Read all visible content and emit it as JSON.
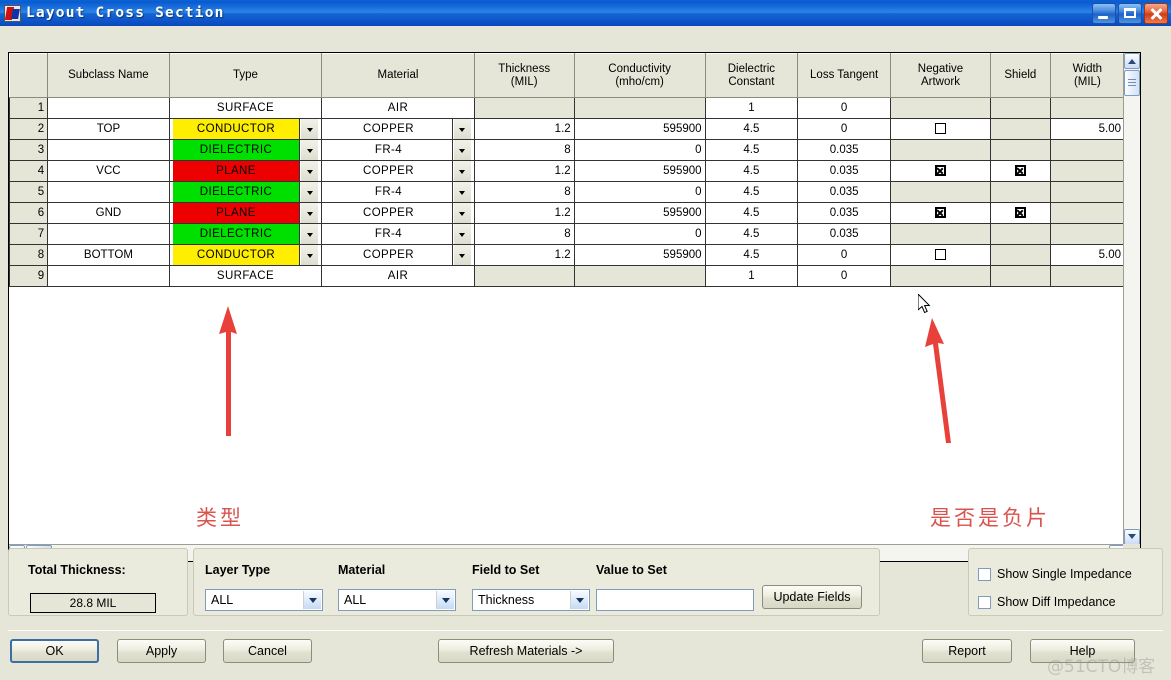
{
  "window": {
    "title": "Layout Cross Section",
    "icon": "app-icon",
    "buttons": {
      "minimize": "minimize",
      "maximize": "maximize",
      "close": "close"
    }
  },
  "grid": {
    "columns": [
      {
        "key": "rownum",
        "label": ""
      },
      {
        "key": "subclass",
        "label": "Subclass Name"
      },
      {
        "key": "type",
        "label": "Type"
      },
      {
        "key": "material",
        "label": "Material"
      },
      {
        "key": "thickness",
        "label": "Thickness\n(MIL)"
      },
      {
        "key": "conductivity",
        "label": "Conductivity\n(mho/cm)"
      },
      {
        "key": "dielectric",
        "label": "Dielectric\nConstant"
      },
      {
        "key": "loss",
        "label": "Loss Tangent"
      },
      {
        "key": "negative",
        "label": "Negative\nArtwork"
      },
      {
        "key": "shield",
        "label": "Shield"
      },
      {
        "key": "width",
        "label": "Width\n(MIL)"
      }
    ],
    "header_lines": {
      "thickness": [
        "Thickness",
        "(MIL)"
      ],
      "conductivity": [
        "Conductivity",
        "(mho/cm)"
      ],
      "dielectric": [
        "Dielectric",
        "Constant"
      ],
      "loss": [
        "Loss Tangent"
      ],
      "negative": [
        "Negative",
        "Artwork"
      ],
      "shield": [
        "Shield"
      ],
      "width": [
        "Width",
        "(MIL)"
      ],
      "subclass": [
        "Subclass Name"
      ],
      "type": [
        "Type"
      ],
      "material": [
        "Material"
      ]
    },
    "rows": [
      {
        "n": "1",
        "subclass": "",
        "type": "SURFACE",
        "type_color": "none",
        "type_combo": false,
        "material": "AIR",
        "material_combo": false,
        "thickness": "",
        "conductivity": "",
        "dielectric": "1",
        "loss": "0",
        "negative": "none",
        "shield": "none",
        "width": ""
      },
      {
        "n": "2",
        "subclass": "TOP",
        "type": "CONDUCTOR",
        "type_color": "yellow",
        "type_combo": true,
        "material": "COPPER",
        "material_combo": true,
        "thickness": "1.2",
        "conductivity": "595900",
        "dielectric": "4.5",
        "loss": "0",
        "negative": "unchecked",
        "shield": "none",
        "width": "5.00"
      },
      {
        "n": "3",
        "subclass": "",
        "type": "DIELECTRIC",
        "type_color": "green",
        "type_combo": true,
        "material": "FR-4",
        "material_combo": true,
        "thickness": "8",
        "conductivity": "0",
        "dielectric": "4.5",
        "loss": "0.035",
        "negative": "none",
        "shield": "none",
        "width": ""
      },
      {
        "n": "4",
        "subclass": "VCC",
        "type": "PLANE",
        "type_color": "red",
        "type_combo": true,
        "material": "COPPER",
        "material_combo": true,
        "thickness": "1.2",
        "conductivity": "595900",
        "dielectric": "4.5",
        "loss": "0.035",
        "negative": "checked",
        "shield": "checked",
        "width": ""
      },
      {
        "n": "5",
        "subclass": "",
        "type": "DIELECTRIC",
        "type_color": "green",
        "type_combo": true,
        "material": "FR-4",
        "material_combo": true,
        "thickness": "8",
        "conductivity": "0",
        "dielectric": "4.5",
        "loss": "0.035",
        "negative": "none",
        "shield": "none",
        "width": ""
      },
      {
        "n": "6",
        "subclass": "GND",
        "type": "PLANE",
        "type_color": "red",
        "type_combo": true,
        "material": "COPPER",
        "material_combo": true,
        "thickness": "1.2",
        "conductivity": "595900",
        "dielectric": "4.5",
        "loss": "0.035",
        "negative": "checked",
        "shield": "checked",
        "width": ""
      },
      {
        "n": "7",
        "subclass": "",
        "type": "DIELECTRIC",
        "type_color": "green",
        "type_combo": true,
        "material": "FR-4",
        "material_combo": true,
        "thickness": "8",
        "conductivity": "0",
        "dielectric": "4.5",
        "loss": "0.035",
        "negative": "none",
        "shield": "none",
        "width": ""
      },
      {
        "n": "8",
        "subclass": "BOTTOM",
        "type": "CONDUCTOR",
        "type_color": "yellow",
        "type_combo": true,
        "material": "COPPER",
        "material_combo": true,
        "thickness": "1.2",
        "conductivity": "595900",
        "dielectric": "4.5",
        "loss": "0",
        "negative": "unchecked",
        "shield": "none",
        "width": "5.00"
      },
      {
        "n": "9",
        "subclass": "",
        "type": "SURFACE",
        "type_color": "none",
        "type_combo": false,
        "material": "AIR",
        "material_combo": false,
        "thickness": "",
        "conductivity": "",
        "dielectric": "1",
        "loss": "0",
        "negative": "none",
        "shield": "none",
        "width": ""
      }
    ]
  },
  "annotations": [
    {
      "name": "type-annotation",
      "text": "类型"
    },
    {
      "name": "negative-artwork-annotation",
      "text": "是否是负片"
    }
  ],
  "bottom": {
    "total_thickness_label": "Total Thickness:",
    "total_thickness_value": "28.8 MIL",
    "layer_type_label": "Layer Type",
    "layer_type_value": "ALL",
    "material_label": "Material",
    "material_value": "ALL",
    "field_to_set_label": "Field to Set",
    "field_to_set_value": "Thickness",
    "value_to_set_label": "Value to Set",
    "value_to_set_value": "",
    "update_fields_label": "Update Fields",
    "show_single_impedance_label": "Show Single Impedance",
    "show_diff_impedance_label": "Show Diff Impedance"
  },
  "footer": {
    "ok": "OK",
    "apply": "Apply",
    "cancel": "Cancel",
    "refresh_materials": "Refresh Materials ->",
    "report": "Report",
    "help": "Help"
  },
  "watermark": "@51CTO博客",
  "colors": {
    "title_blue": "#0a5ad0",
    "conductor_yellow": "#ffee00",
    "dielectric_green": "#00e000",
    "plane_red": "#ee0000",
    "annotation_red": "#d9534f",
    "dialog_bg": "#e6e6d8"
  }
}
